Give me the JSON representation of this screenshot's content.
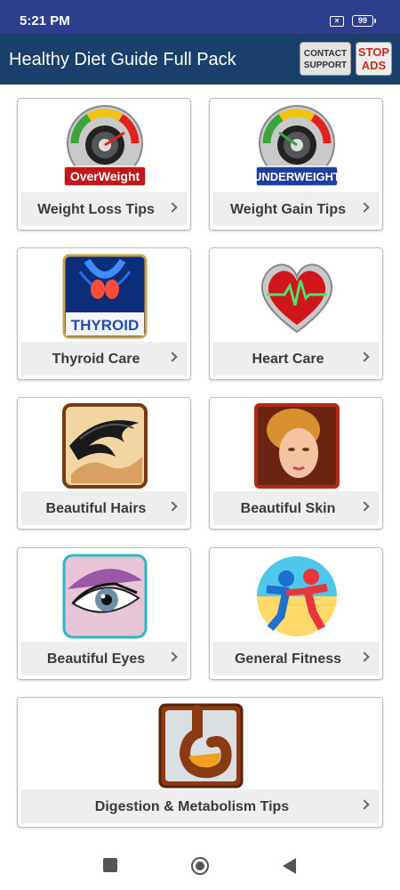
{
  "status_bar": {
    "time": "5:21 PM",
    "battery": "99"
  },
  "app_bar": {
    "title": "Healthy Diet Guide Full Pack",
    "contact_line1": "CONTACT",
    "contact_line2": "SUPPORT",
    "stop_line1": "STOP",
    "stop_line2": "ADS"
  },
  "tiles": [
    {
      "label": "Weight Loss Tips",
      "icon": "overweight-gauge-icon",
      "badge": "OverWeight"
    },
    {
      "label": "Weight Gain Tips",
      "icon": "underweight-gauge-icon",
      "badge": "UNDERWEIGHT"
    },
    {
      "label": "Thyroid Care",
      "icon": "thyroid-icon",
      "badge": "THYROID"
    },
    {
      "label": "Heart Care",
      "icon": "heart-icon"
    },
    {
      "label": "Beautiful Hairs",
      "icon": "hair-icon"
    },
    {
      "label": "Beautiful Skin",
      "icon": "skin-face-icon"
    },
    {
      "label": "Beautiful Eyes",
      "icon": "eye-icon"
    },
    {
      "label": "General Fitness",
      "icon": "fitness-people-icon"
    },
    {
      "label": "Digestion & Metabolism Tips",
      "icon": "stomach-icon"
    }
  ],
  "colors": {
    "status_bar": "#2e3d8d",
    "app_bar": "#193f6b",
    "stop_ads": "#c62a1f"
  }
}
